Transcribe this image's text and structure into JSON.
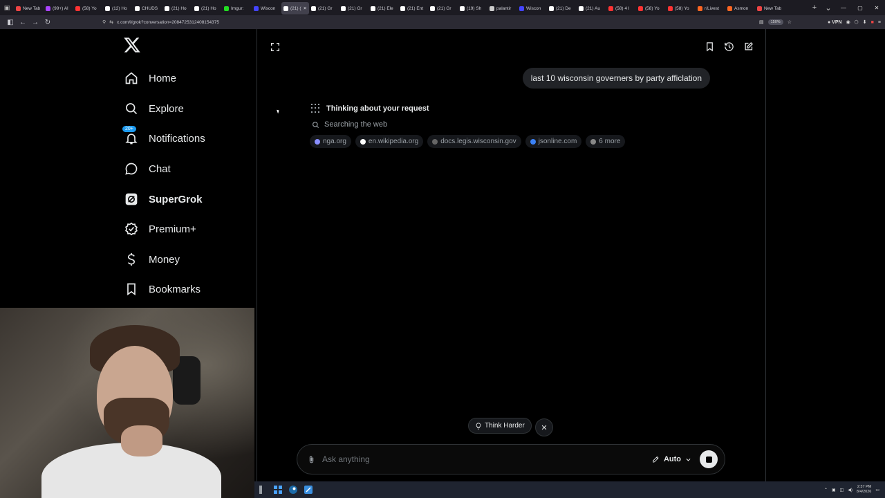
{
  "browser": {
    "tabs": [
      {
        "label": "New Tab",
        "color": "#e44"
      },
      {
        "label": "(99+) Al",
        "color": "#a4f"
      },
      {
        "label": "(58) Yo",
        "color": "#f33"
      },
      {
        "label": "(12) Ho",
        "color": "#fff"
      },
      {
        "label": "CHUDS",
        "color": "#fff"
      },
      {
        "label": "(21) Ho",
        "color": "#fff"
      },
      {
        "label": "(21) Ho",
        "color": "#fff"
      },
      {
        "label": "Imgur:",
        "color": "#2d2"
      },
      {
        "label": "Wiscon",
        "color": "#44f"
      },
      {
        "label": "(21) (",
        "color": "#fff",
        "active": true
      },
      {
        "label": "(21) Gr",
        "color": "#fff"
      },
      {
        "label": "(21) Gr",
        "color": "#fff"
      },
      {
        "label": "(21) Ele",
        "color": "#fff"
      },
      {
        "label": "(21) Ent",
        "color": "#fff"
      },
      {
        "label": "(21) Gr",
        "color": "#fff"
      },
      {
        "label": "(19) Sh",
        "color": "#fff"
      },
      {
        "label": "palantir",
        "color": "#ccc"
      },
      {
        "label": "Wiscon",
        "color": "#44f"
      },
      {
        "label": "(21) De",
        "color": "#fff"
      },
      {
        "label": "(21) Au",
        "color": "#fff"
      },
      {
        "label": "(58) 4 I",
        "color": "#f33"
      },
      {
        "label": "(58) Yo",
        "color": "#f33"
      },
      {
        "label": "(58) Yo",
        "color": "#f33"
      },
      {
        "label": "r/Livest",
        "color": "#f62"
      },
      {
        "label": "Asmon",
        "color": "#f62"
      },
      {
        "label": "New Tab",
        "color": "#e44"
      }
    ],
    "url": "x.com/i/grok?conversation=2084725312408154375",
    "zoom": "150%",
    "vpn": "VPN"
  },
  "sidebar": {
    "items": [
      {
        "label": "Home",
        "icon": "home-icon"
      },
      {
        "label": "Explore",
        "icon": "search-icon"
      },
      {
        "label": "Notifications",
        "icon": "bell-icon",
        "badge": "20+"
      },
      {
        "label": "Chat",
        "icon": "chat-icon"
      },
      {
        "label": "SuperGrok",
        "icon": "grok-icon"
      },
      {
        "label": "Premium+",
        "icon": "verified-icon"
      },
      {
        "label": "Money",
        "icon": "dollar-icon"
      },
      {
        "label": "Bookmarks",
        "icon": "bookmark-icon"
      }
    ]
  },
  "chat": {
    "user_message": "last 10 wisconsin governers by party afficlation",
    "thinking_label": "Thinking about your request",
    "searching_label": "Searching the web",
    "sources": [
      {
        "label": "nga.org",
        "color": "#8a8fff"
      },
      {
        "label": "en.wikipedia.org",
        "color": "#ffffff"
      },
      {
        "label": "docs.legis.wisconsin.gov",
        "color": "#666666"
      },
      {
        "label": "jsonline.com",
        "color": "#3b82f6"
      },
      {
        "label": "6 more",
        "color": "#888888"
      }
    ],
    "think_harder_label": "Think Harder"
  },
  "composer": {
    "placeholder": "Ask anything",
    "mode": "Auto"
  },
  "taskbar": {
    "time": "2:37 PM",
    "date": "8/4/2026"
  }
}
